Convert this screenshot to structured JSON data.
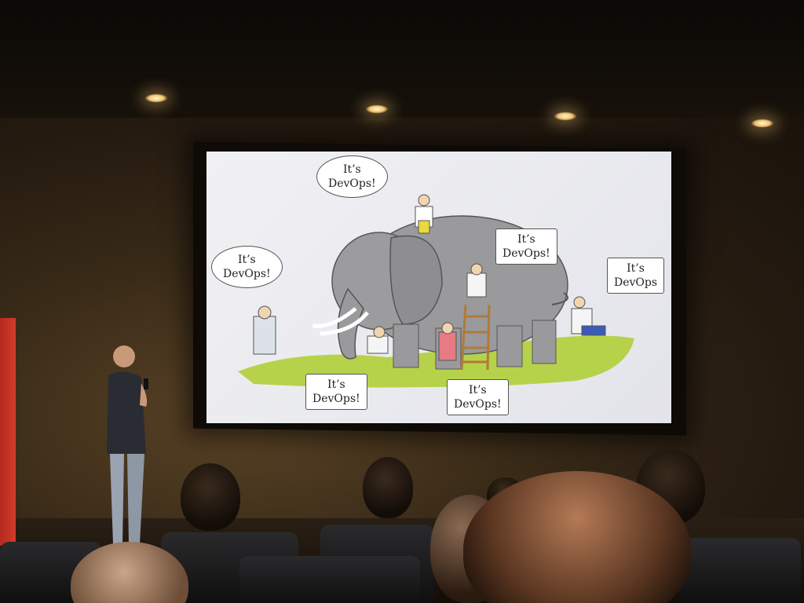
{
  "slide": {
    "bubbles": [
      {
        "id": "top",
        "line1": "It’s",
        "line2": "DevOps!"
      },
      {
        "id": "left",
        "line1": "It’s",
        "line2": "DevOps!"
      },
      {
        "id": "mid-right",
        "line1": "It’s",
        "line2": "DevOps!"
      },
      {
        "id": "far-right",
        "line1": "It’s",
        "line2": "DevOps"
      },
      {
        "id": "bottom-left",
        "line1": "It’s",
        "line2": "DevOps!"
      },
      {
        "id": "bottom-mid",
        "line1": "It’s",
        "line2": "DevOps!"
      }
    ]
  },
  "colors": {
    "elephant": "#9a9a9c",
    "grass": "#b6d24a",
    "slide_bg": "#eceef2",
    "banner": "#c93122"
  }
}
